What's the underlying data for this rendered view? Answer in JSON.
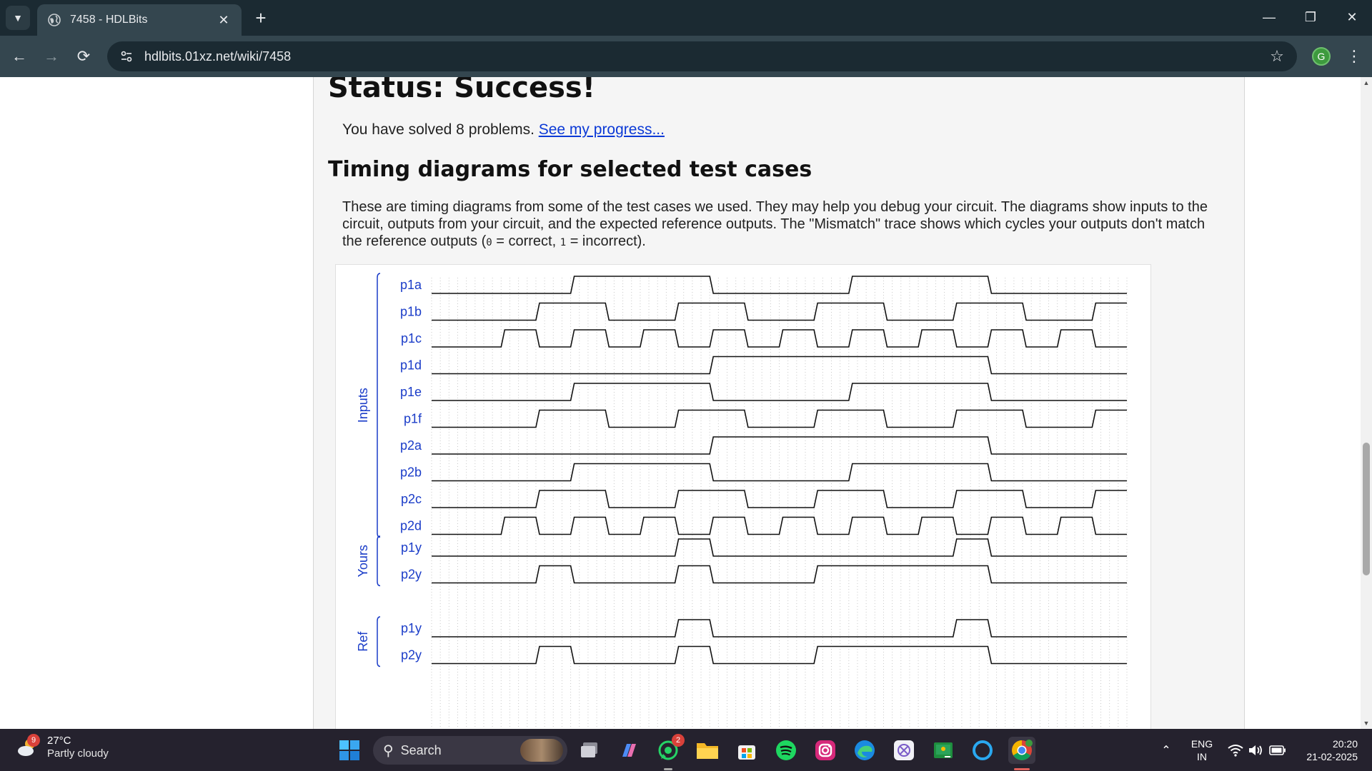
{
  "browser": {
    "tab_title": "7458 - HDLBits",
    "url": "hdlbits.01xz.net/wiki/7458",
    "profile_initial": "G"
  },
  "page": {
    "status_heading": "Status: Success!",
    "solved_text": "You have solved 8 problems. ",
    "progress_link": "See my progress...",
    "section_heading": "Timing diagrams for selected test cases",
    "description_1": "These are timing diagrams from some of the test cases we used. They may help you debug your circuit. The diagrams show inputs to the circuit, outputs from your circuit, and the expected reference outputs. The \"Mismatch\" trace shows which cycles your outputs don't match the reference outputs (",
    "code_zero": "0",
    "description_2": " = correct, ",
    "code_one": "1",
    "description_3": " = incorrect)."
  },
  "timing": {
    "groups": [
      {
        "label": "Inputs",
        "signals": [
          {
            "name": "p1a",
            "wave": [
              0,
              0,
              0,
              0,
              1,
              1,
              1,
              1,
              0,
              0,
              0,
              0,
              1,
              1,
              1,
              1,
              0,
              0,
              0,
              0
            ]
          },
          {
            "name": "p1b",
            "wave": [
              0,
              0,
              0,
              1,
              1,
              0,
              0,
              1,
              1,
              0,
              0,
              1,
              1,
              0,
              0,
              1,
              1,
              0,
              0,
              1
            ]
          },
          {
            "name": "p1c",
            "wave": [
              0,
              0,
              1,
              0,
              1,
              0,
              1,
              0,
              1,
              0,
              1,
              0,
              1,
              0,
              1,
              0,
              1,
              0,
              1,
              0
            ]
          },
          {
            "name": "p1d",
            "wave": [
              0,
              0,
              0,
              0,
              0,
              0,
              0,
              0,
              1,
              1,
              1,
              1,
              1,
              1,
              1,
              1,
              0,
              0,
              0,
              0
            ]
          },
          {
            "name": "p1e",
            "wave": [
              0,
              0,
              0,
              0,
              1,
              1,
              1,
              1,
              0,
              0,
              0,
              0,
              1,
              1,
              1,
              1,
              0,
              0,
              0,
              0
            ]
          },
          {
            "name": "p1f",
            "wave": [
              0,
              0,
              0,
              1,
              1,
              0,
              0,
              1,
              1,
              0,
              0,
              1,
              1,
              0,
              0,
              1,
              1,
              0,
              0,
              1
            ]
          },
          {
            "name": "p2a",
            "wave": [
              0,
              0,
              0,
              0,
              0,
              0,
              0,
              0,
              1,
              1,
              1,
              1,
              1,
              1,
              1,
              1,
              0,
              0,
              0,
              0
            ]
          },
          {
            "name": "p2b",
            "wave": [
              0,
              0,
              0,
              0,
              1,
              1,
              1,
              1,
              0,
              0,
              0,
              0,
              1,
              1,
              1,
              1,
              0,
              0,
              0,
              0
            ]
          },
          {
            "name": "p2c",
            "wave": [
              0,
              0,
              0,
              1,
              1,
              0,
              0,
              1,
              1,
              0,
              0,
              1,
              1,
              0,
              0,
              1,
              1,
              0,
              0,
              1
            ]
          },
          {
            "name": "p2d",
            "wave": [
              0,
              0,
              1,
              0,
              1,
              0,
              1,
              0,
              1,
              0,
              1,
              0,
              1,
              0,
              1,
              0,
              1,
              0,
              1,
              0
            ]
          }
        ]
      },
      {
        "label": "Yours",
        "signals": [
          {
            "name": "p1y",
            "wave": [
              0,
              0,
              0,
              0,
              0,
              0,
              0,
              1,
              0,
              0,
              0,
              0,
              0,
              0,
              0,
              1,
              0,
              0,
              0,
              0
            ]
          },
          {
            "name": "p2y",
            "wave": [
              0,
              0,
              0,
              1,
              0,
              0,
              0,
              1,
              0,
              0,
              0,
              1,
              1,
              1,
              1,
              1,
              0,
              0,
              0,
              0
            ]
          }
        ]
      },
      {
        "label": "Ref",
        "signals": [
          {
            "name": "p1y",
            "wave": [
              0,
              0,
              0,
              0,
              0,
              0,
              0,
              1,
              0,
              0,
              0,
              0,
              0,
              0,
              0,
              1,
              0,
              0,
              0,
              0
            ]
          },
          {
            "name": "p2y",
            "wave": [
              0,
              0,
              0,
              1,
              0,
              0,
              0,
              1,
              0,
              0,
              0,
              1,
              1,
              1,
              1,
              1,
              0,
              0,
              0,
              0
            ]
          }
        ]
      }
    ],
    "colors": {
      "wave": "#111111",
      "label": "#1a3cc8",
      "bracket": "#1a3cc8",
      "grid": "#c8c8c8"
    }
  },
  "taskbar": {
    "weather_temp": "27°C",
    "weather_desc": "Partly cloudy",
    "weather_badge": "9",
    "search_label": "Search",
    "whatsapp_badge": "2",
    "lang_top": "ENG",
    "lang_bottom": "IN",
    "time": "20:20",
    "date": "21-02-2025"
  }
}
